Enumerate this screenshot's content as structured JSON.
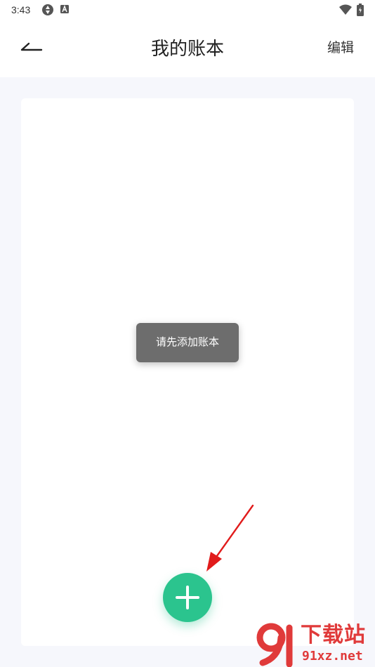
{
  "status_bar": {
    "time": "3:43",
    "icons": [
      "sync-icon",
      "a-badge-icon",
      "wifi-icon",
      "battery-icon"
    ]
  },
  "header": {
    "back_icon": "back-arrow-icon",
    "title": "我的账本",
    "edit_label": "编辑"
  },
  "toast": {
    "message": "请先添加账本"
  },
  "fab": {
    "icon": "plus-icon",
    "color": "#2bc48e"
  },
  "annotation": {
    "icon": "red-arrow-icon",
    "color": "#e11b1b"
  },
  "watermark": {
    "logo": "91-logo-icon",
    "title": "下载站",
    "domain": "91xz.net",
    "color": "#e03a3a"
  },
  "colors": {
    "page_background": "#f6f7fc",
    "card_background": "#ffffff",
    "toast_background": "#6d6d6d"
  }
}
